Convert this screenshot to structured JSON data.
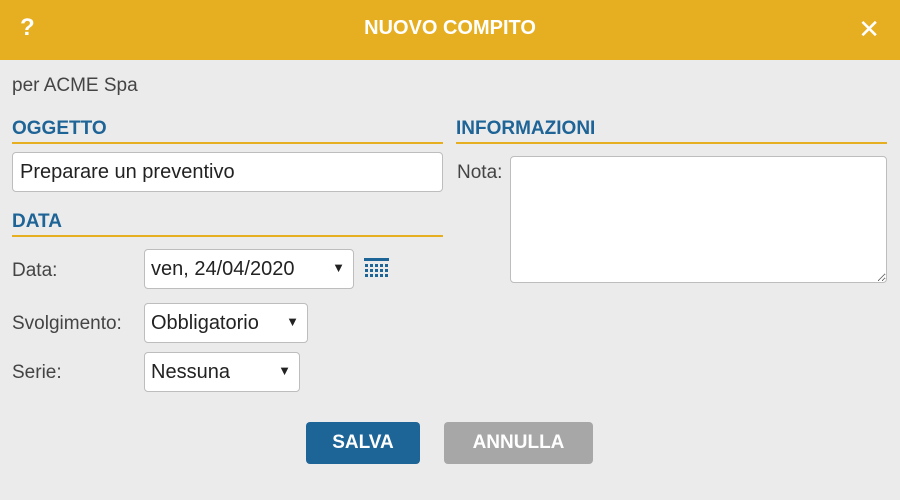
{
  "dialog": {
    "title": "NUOVO COMPITO",
    "help_glyph": "?",
    "close_glyph": "✕",
    "subtitle": "per ACME Spa"
  },
  "oggetto": {
    "heading": "OGGETTO",
    "value": "Preparare un preventivo"
  },
  "data_section": {
    "heading": "DATA",
    "date_label": "Data:",
    "date_value": "ven, 24/04/2020",
    "svolgimento_label": "Svolgimento:",
    "svolgimento_value": "Obbligatorio",
    "serie_label": "Serie:",
    "serie_value": "Nessuna",
    "dropdown_glyph": "▼"
  },
  "informazioni": {
    "heading": "INFORMAZIONI",
    "nota_label": "Nota:",
    "nota_value": ""
  },
  "actions": {
    "save_label": "SALVA",
    "cancel_label": "ANNULLA"
  },
  "colors": {
    "header_bg": "#e6af22",
    "accent_blue": "#1d6497",
    "cancel_gray": "#a7a7a7",
    "dialog_bg": "#ebebeb"
  },
  "icons": {
    "help": "question-mark-icon",
    "close": "close-icon",
    "calendar": "calendar-icon",
    "dropdown": "triangle-down-icon"
  }
}
